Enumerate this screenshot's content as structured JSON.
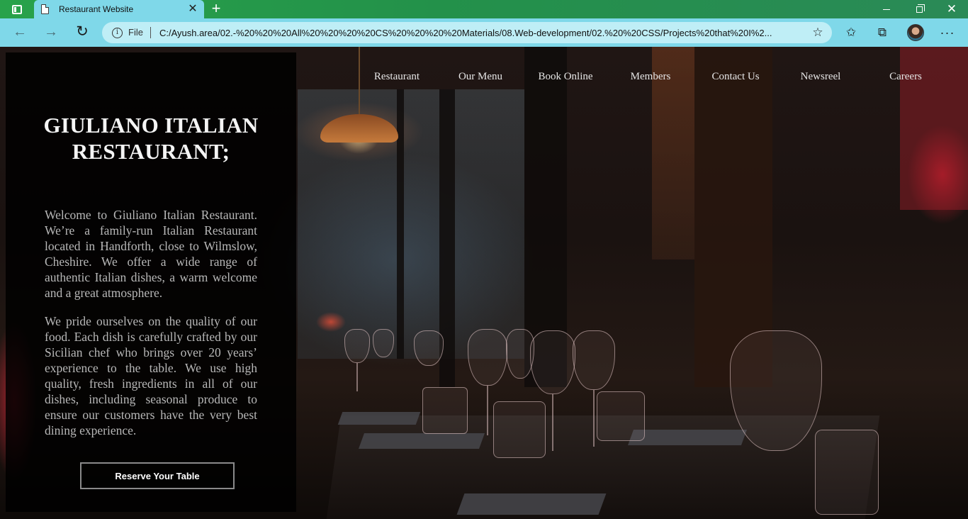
{
  "browser": {
    "tab_title": "Restaurant Website",
    "tab_close": "✕",
    "new_tab": "+",
    "address_prefix": "File",
    "url": "C:/Ayush.area/02.-%20%20%20All%20%20%20%20CS%20%20%20%20Materials/08.Web-development/02.%20%20CSS/Projects%20that%20I%2...",
    "icons": [
      "window-icon",
      "page-icon",
      "back-icon",
      "forward-icon",
      "reload-icon",
      "info-icon",
      "favorite-star-icon",
      "favorites-icon",
      "collections-icon",
      "profile-avatar",
      "more-icon"
    ]
  },
  "nav": {
    "items": [
      "Restaurant",
      "Our Menu",
      "Book Online",
      "Members",
      "Contact Us",
      "Newsreel",
      "Careers"
    ]
  },
  "hero": {
    "title": "GIULIANO ITALIAN RESTAURANT;",
    "para1": "Welcome to Giuliano Italian Restaurant. We’re a family-run Italian Restaurant located in Handforth, close to Wilmslow, Cheshire. We offer a wide range of authentic Italian dishes, a warm welcome and a great atmosphere.",
    "para2": "We pride ourselves on the quality of our food. Each dish is carefully crafted by our Sicilian chef who brings over 20 years’ experience to the table. We use high quality, fresh ingredients in all of our dishes, including seasonal produce to ensure our customers have the very best dining experience.",
    "button": "Reserve Your Table"
  },
  "colors": {
    "tab_bar": "#23914a",
    "toolbar": "#7fd8e9",
    "address_bar": "#bfeef6",
    "panel": "#000000"
  }
}
